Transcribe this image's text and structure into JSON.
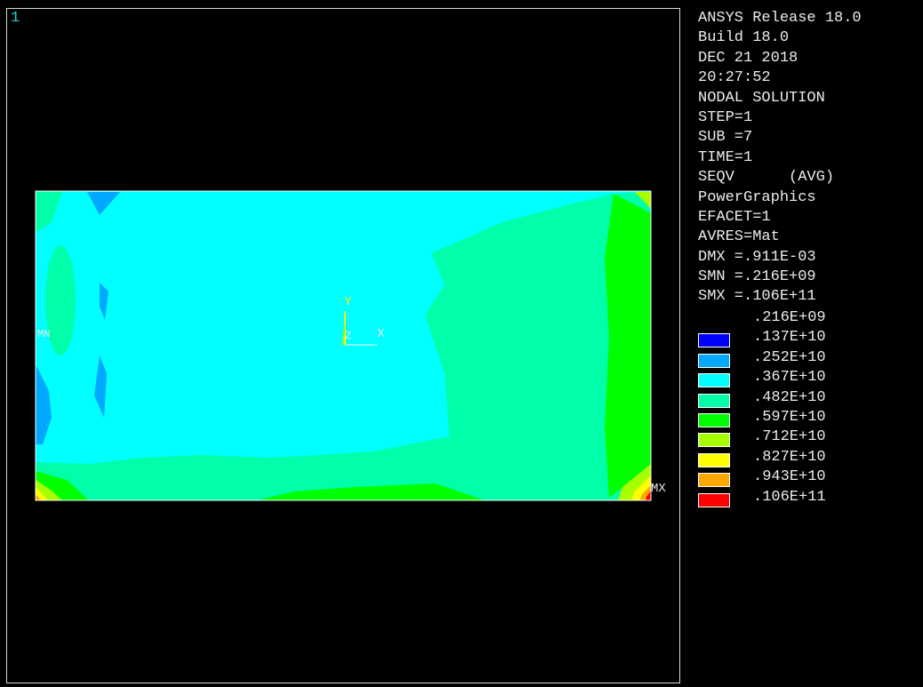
{
  "window_number": "1",
  "info_lines": [
    "ANSYS Release 18.0",
    "Build 18.0",
    "DEC 21 2018",
    "20:27:52",
    "NODAL SOLUTION",
    "STEP=1",
    "SUB =7",
    "TIME=1",
    "SEQV      (AVG)",
    "PowerGraphics",
    "EFACET=1",
    "AVRES=Mat",
    "DMX =.911E-03",
    "SMN =.216E+09",
    "SMX =.106E+11"
  ],
  "legend_top_value": ".216E+09",
  "legend": [
    {
      "color": "#0000ff",
      "value": ".137E+10"
    },
    {
      "color": "#00a8ff",
      "value": ".252E+10"
    },
    {
      "color": "#00ffff",
      "value": ".367E+10"
    },
    {
      "color": "#00ffa8",
      "value": ".482E+10"
    },
    {
      "color": "#00ff00",
      "value": ".597E+10"
    },
    {
      "color": "#a8ff00",
      "value": ".712E+10"
    },
    {
      "color": "#ffff00",
      "value": ".827E+10"
    },
    {
      "color": "#ffa800",
      "value": ".943E+10"
    },
    {
      "color": "#ff0000",
      "value": ".106E+11"
    }
  ],
  "markers": {
    "min_label": "MN",
    "max_label": "MX"
  },
  "triad": {
    "x_label": "X",
    "y_label": "Y",
    "z_label": "Z"
  },
  "colors": {
    "frame": "#d8d8d8",
    "text": "#ececec",
    "window_number": "#1fd0d0"
  }
}
